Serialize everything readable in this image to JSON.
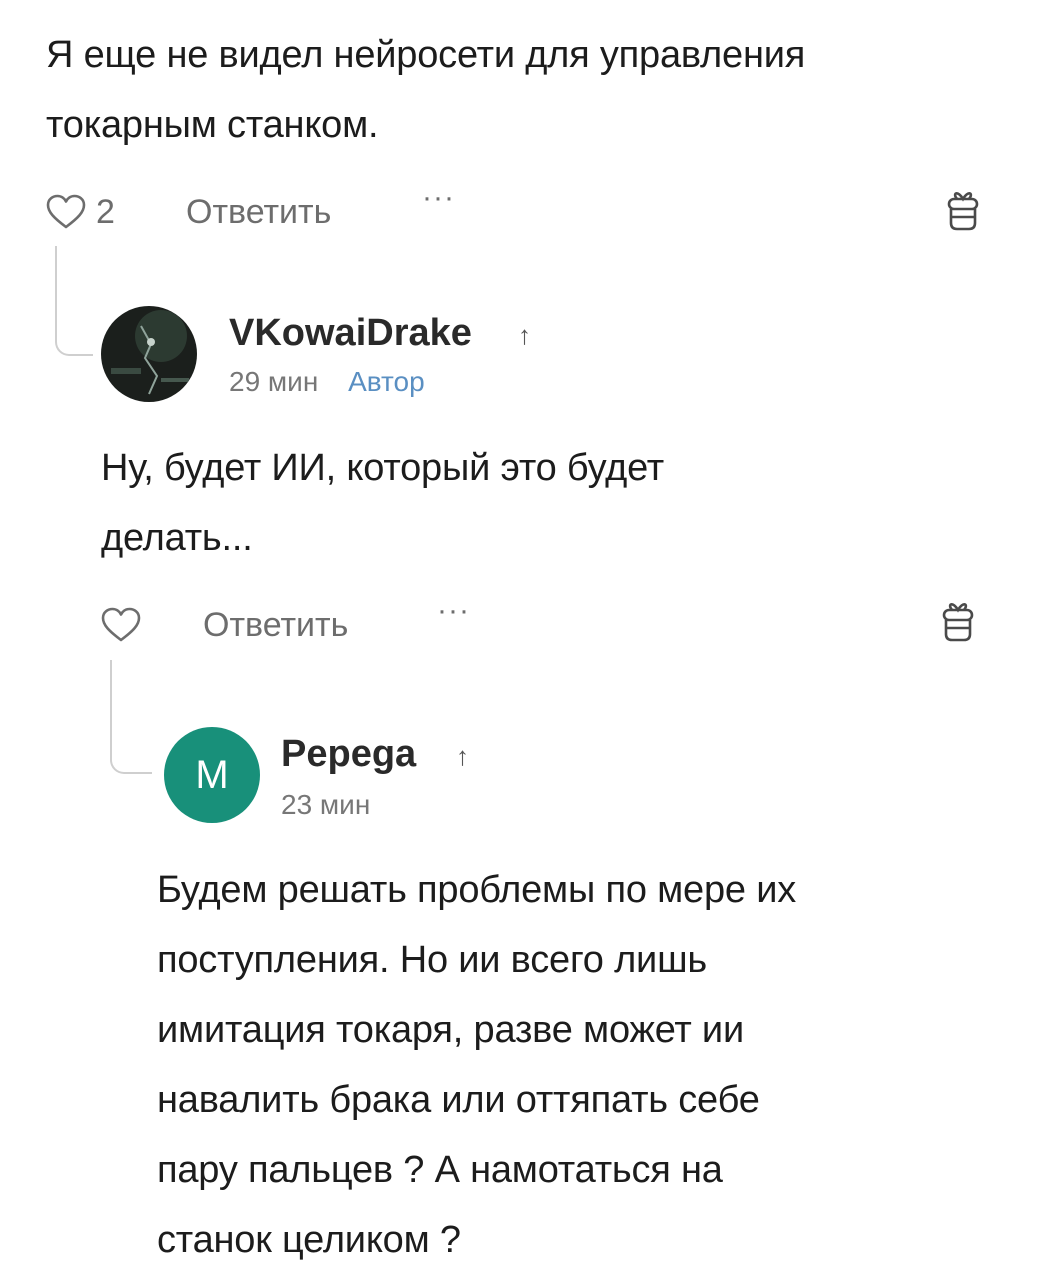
{
  "comment1": {
    "text_lines": [
      "Я еще не видел нейросети для управления",
      "токарным станком."
    ],
    "likes": "2",
    "reply_label": "Ответить",
    "more_label": "···"
  },
  "comment2": {
    "author": "VKowaiDrake",
    "arrow": "↑",
    "time": "29 мин",
    "badge": "Автор",
    "text_lines": [
      "Ну, будет ИИ, который это будет",
      "делать..."
    ],
    "reply_label": "Ответить",
    "more_label": "···"
  },
  "comment3": {
    "avatar_letter": "M",
    "avatar_color": "#18907a",
    "author": "Pepega",
    "arrow": "↑",
    "time": "23 мин",
    "text_lines": [
      "Будем решать проблемы по мере их",
      "поступления. Но ии всего лишь",
      "имитация токаря, разве может ии",
      "навалить брака или оттяпать себе",
      "пару пальцев ? А намотаться на",
      "станок целиком ?"
    ]
  },
  "icons": [
    "heart-icon",
    "gift-icon",
    "reply-arrow-icon"
  ]
}
